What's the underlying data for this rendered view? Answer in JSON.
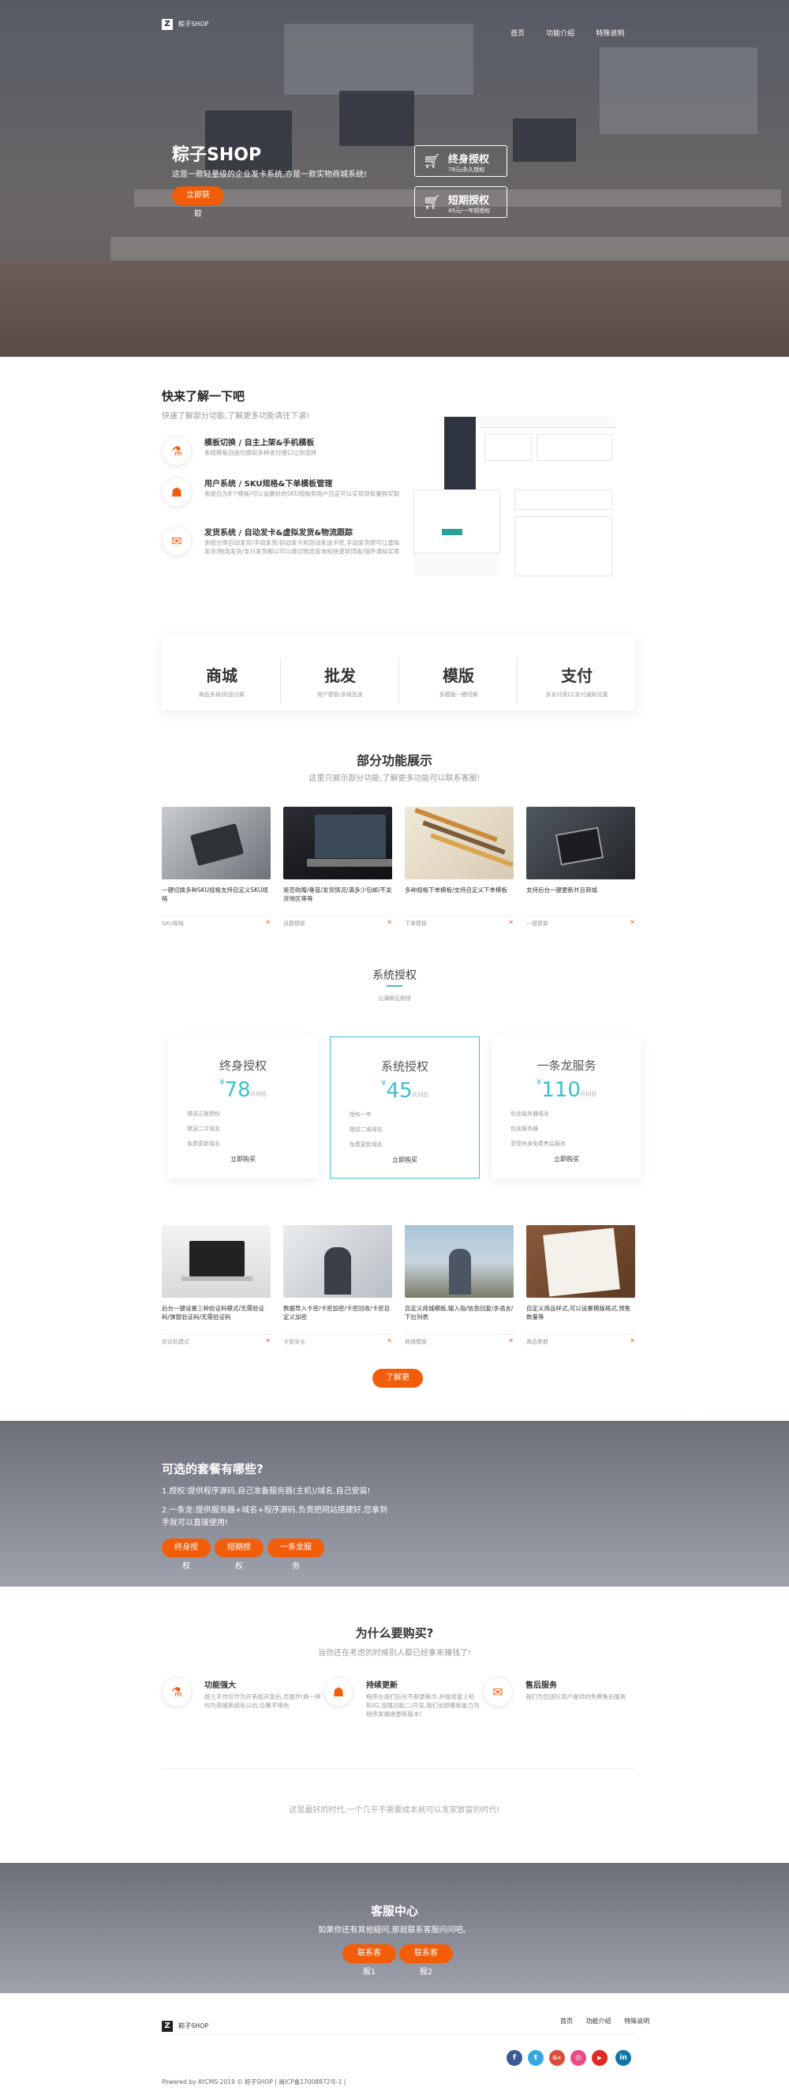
{
  "header": {
    "logo_text": "粽子SHOP",
    "nav": [
      "首页",
      "功能介绍",
      "特殊说明"
    ]
  },
  "hero": {
    "title": "粽子SHOP",
    "subtitle": "这是一款轻量级的企业发卡系统,亦是一款实物商城系统!",
    "cta": "立即获取",
    "cards": [
      {
        "title": "终身授权",
        "sub": "78元/永久授权"
      },
      {
        "title": "短期授权",
        "sub": "45元/一年短授权"
      }
    ]
  },
  "intro": {
    "title": "快来了解一下吧",
    "subtitle": "快速了解部分功能,了解更多功能请往下滚!",
    "features": [
      {
        "icon": "flask-icon",
        "title": "模板切换 / 自主上架&手机模板",
        "desc": "系统模板自由切换和多种支付接口让你选择"
      },
      {
        "icon": "users-icon",
        "title": "用户系统 / SKU规格&下单模板管理",
        "desc": "系统自为8个模板/可以设置好的SKU规格到用户自定可以实现现批量购买取"
      },
      {
        "icon": "chat-icon",
        "title": "发货系统 / 自动发卡&虚拟发货&物流跟踪",
        "desc": "系统分类自动发货/手动发货/自动发卡和自动发送卡密,手动发货即可让虚拟发货/物流发货/支付发货都以可以通过物流查询和快速到顶级/插件通知买家"
      }
    ]
  },
  "stats": [
    {
      "big": "商城",
      "small": "商品多规/防恶付款"
    },
    {
      "big": "批发",
      "small": "用户模板/多级批发"
    },
    {
      "big": "模版",
      "small": "多模版一键切换"
    },
    {
      "big": "支付",
      "small": "多支付接口/支付通知设置"
    }
  ],
  "showcase": {
    "title": "部分功能展示",
    "subtitle": "这里只展示部分功能,了解更多功能可以联系客服!",
    "cards": [
      {
        "caption": "一键切换多种SKU规格支持自定义SKU规格",
        "tag": "SKU规格"
      },
      {
        "caption": "是否购赠/垂篮/发货情况/满多少包邮/不发货地区等等",
        "tag": "运费模板"
      },
      {
        "caption": "多种规格下单模板/支持自定义下单模板",
        "tag": "下单模板"
      },
      {
        "caption": "支持后台一键更新并且商城",
        "tag": "一键更新"
      }
    ]
  },
  "pricing": {
    "title": "系统授权",
    "subtitle": "沾满瞬后期授",
    "plans": [
      {
        "title": "终身授权",
        "currency": "¥",
        "price": "78",
        "unit": "RMB",
        "features": [
          "赠送正版授权",
          "赠送二次域名",
          "免费更新域名"
        ],
        "btn": "立即购买"
      },
      {
        "title": "系统授权",
        "currency": "¥",
        "price": "45",
        "unit": "RMB",
        "features": [
          "授权一年",
          "赠送二维域名",
          "免费更新域名"
        ],
        "btn": "立即购买"
      },
      {
        "title": "一条龙服务",
        "currency": "¥",
        "price": "110",
        "unit": "RMB",
        "features": [
          "包含服务器域名",
          "包含服务器",
          "享受终身免费售后服务"
        ],
        "btn": "立即购买"
      }
    ]
  },
  "showcase2": {
    "cards": [
      {
        "caption": "后台一键设置三种验证码模式/无需验证码/弹窗验证码/无需验证码",
        "tag": "验证码模式"
      },
      {
        "caption": "数据导入卡密/卡密加密/卡密回收/卡密自定义加密",
        "tag": "卡密安全"
      },
      {
        "caption": "自定义商城模板,输入指/信息回复/多语言/下拉列表",
        "tag": "商城模板"
      },
      {
        "caption": "自定义商品样式,可以设置模版格式,预售数量等",
        "tag": "商品参数"
      }
    ],
    "more_btn": "了解更多"
  },
  "options": {
    "title": "可选的套餐有哪些?",
    "line1": "1.授权:提供程序源码,自己准备服务器(主机)/域名,自己安装!",
    "line2": "2.一条龙:提供服务器+域名+程序源码,负责把网站搭建好,您拿到手就可以直接使用!",
    "buttons": [
      "终身授权",
      "短期授权",
      "一条龙服务"
    ]
  },
  "why": {
    "title": "为什么要购买?",
    "subtitle": "当你还在考虑的时候别人都已经拿来赚钱了!",
    "items": [
      {
        "icon": "flask-icon",
        "title": "功能强大",
        "desc": "超上手作仅作为开系统开发后,页面作(商一样均为商城系统有以后,位置不错色"
      },
      {
        "icon": "users-icon",
        "title": "持续更新",
        "desc": "程序在我们后台不断更新中,并能修复上轮BUG,加强功能二/开发,我们会顾着新能力为程序发展继更新版本!"
      },
      {
        "icon": "chat-icon",
        "title": "售后服务",
        "desc": "我们为您团队用户提供的免费售后服务"
      }
    ],
    "tagline": "这是最好的时代,一个几乎不需要成本就可以发家致富的时代!"
  },
  "support": {
    "title": "客服中心",
    "subtitle": "如果你还有其他疑问,那就联系客服问问吧。",
    "buttons": [
      "联系客服1",
      "联系客服2"
    ]
  },
  "footer": {
    "logo_text": "粽子SHOP",
    "nav": [
      "首页",
      "功能介绍",
      "特殊说明"
    ],
    "copyright": "Powered by AYCMS-2019 © 粽子SHOP | 闽ICP备17008872号-1 |",
    "social": [
      {
        "icon": "facebook-icon",
        "glyph": "f",
        "color": "#3b5998"
      },
      {
        "icon": "twitter-icon",
        "glyph": "t",
        "color": "#35a8e0"
      },
      {
        "icon": "google-plus-icon",
        "glyph": "G+",
        "color": "#dd4b39"
      },
      {
        "icon": "dribbble-icon",
        "glyph": "◎",
        "color": "#ea4c89"
      },
      {
        "icon": "youtube-icon",
        "glyph": "▶",
        "color": "#e02a20"
      },
      {
        "icon": "linkedin-icon",
        "glyph": "in",
        "color": "#0e76a8"
      }
    ]
  },
  "colors": {
    "accent": "#f25d0a",
    "teal": "#3dc0cc"
  }
}
